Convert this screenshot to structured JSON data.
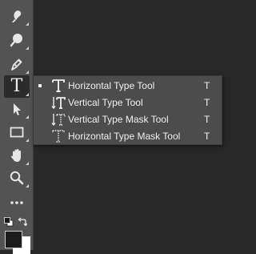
{
  "toolbar": {
    "tools": [
      {
        "name": "smudge-tool",
        "icon": "smudge-icon"
      },
      {
        "name": "dodge-tool",
        "icon": "dodge-icon"
      },
      {
        "name": "pen-tool",
        "icon": "pen-icon"
      },
      {
        "name": "type-tool",
        "icon": "type-icon",
        "glyph": "T",
        "active": true
      },
      {
        "name": "path-selection-tool",
        "icon": "path-selection-arrow-icon"
      },
      {
        "name": "rectangle-tool",
        "icon": "rectangle-icon"
      },
      {
        "name": "hand-tool",
        "icon": "hand-icon"
      },
      {
        "name": "zoom-tool",
        "icon": "magnifier-icon"
      },
      {
        "name": "edit-toolbar",
        "icon": "more-dots-icon",
        "glyph": "•••"
      }
    ],
    "colors": {
      "foreground": "#1b1b1b",
      "background": "#ffffff"
    }
  },
  "flyout": {
    "items": [
      {
        "label": "Horizontal Type Tool",
        "shortcut": "T",
        "icon": "horizontal-type-icon",
        "selected": true
      },
      {
        "label": "Vertical Type Tool",
        "shortcut": "T",
        "icon": "vertical-type-icon",
        "selected": false
      },
      {
        "label": "Vertical Type Mask Tool",
        "shortcut": "T",
        "icon": "vertical-type-mask-icon",
        "selected": false
      },
      {
        "label": "Horizontal Type Mask Tool",
        "shortcut": "T",
        "icon": "horizontal-type-mask-icon",
        "selected": false
      }
    ]
  }
}
